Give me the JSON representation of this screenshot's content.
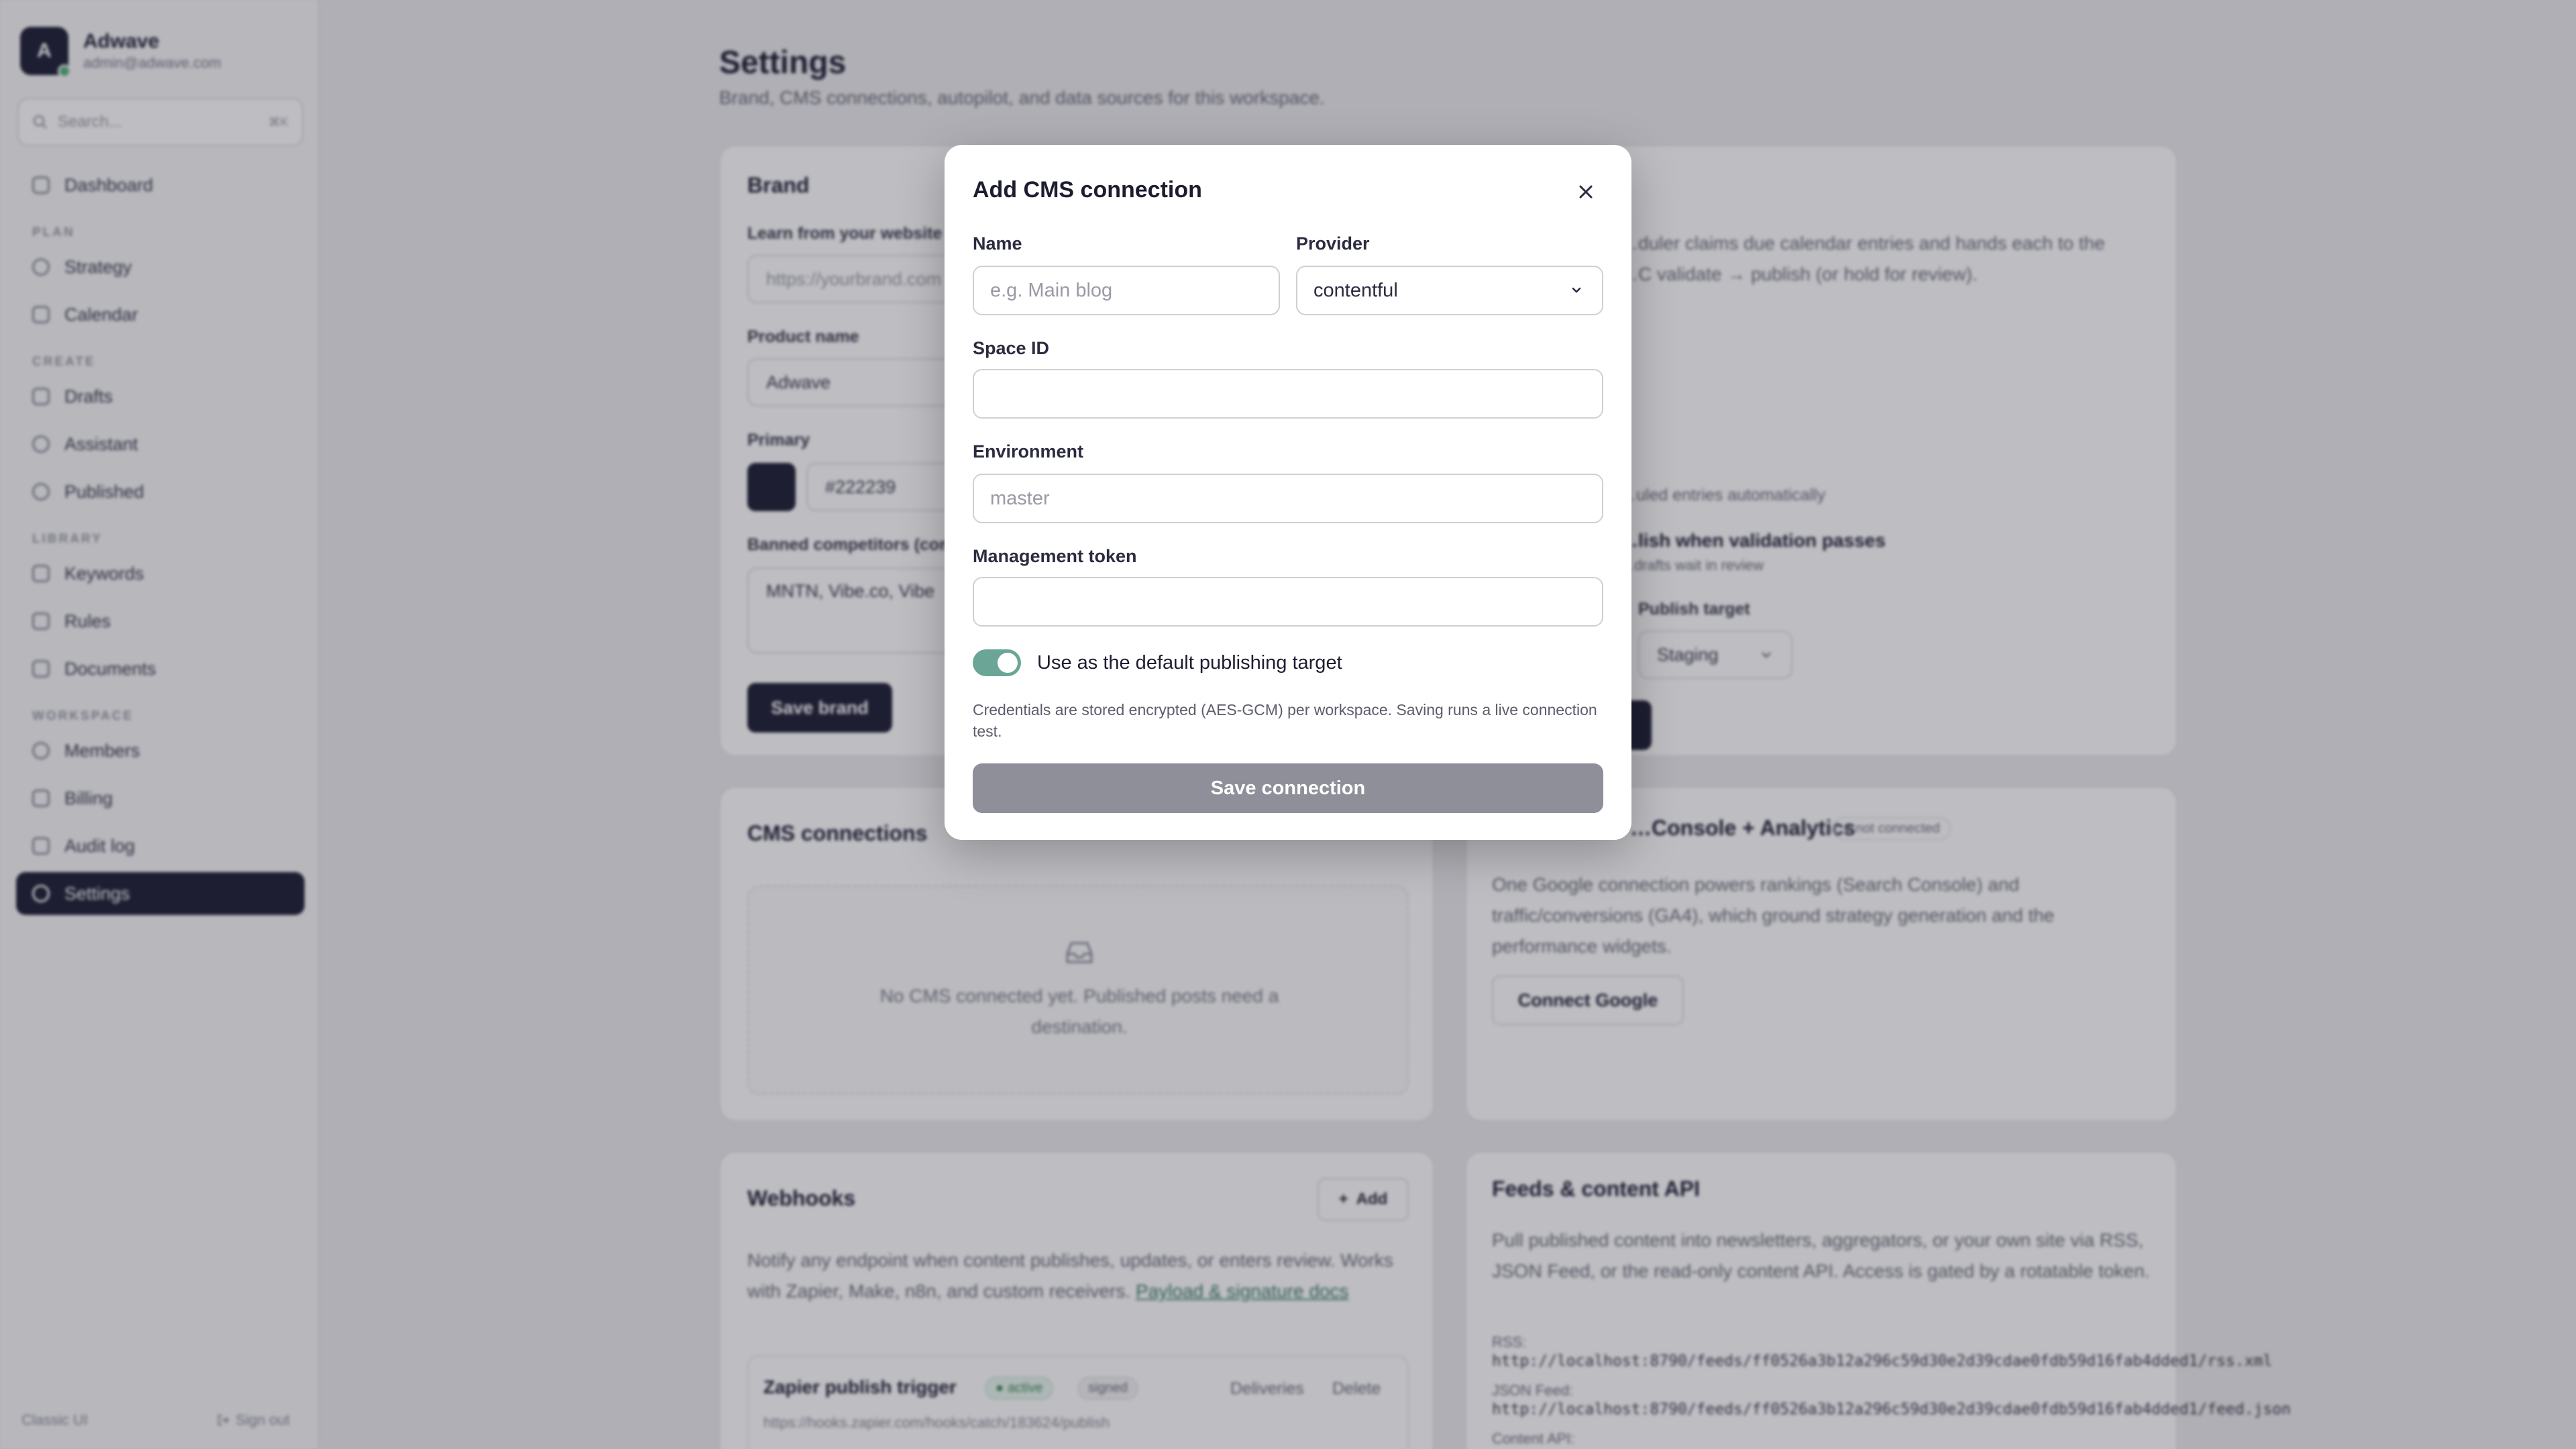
{
  "workspace": {
    "initial": "A",
    "name": "Adwave",
    "email": "admin@adwave.com"
  },
  "search": {
    "placeholder": "Search...",
    "shortcut": "⌘K"
  },
  "nav": {
    "dashboard": "Dashboard",
    "plan_section": "PLAN",
    "strategy": "Strategy",
    "calendar": "Calendar",
    "create_section": "CREATE",
    "drafts": "Drafts",
    "assistant": "Assistant",
    "published": "Published",
    "library_section": "LIBRARY",
    "keywords": "Keywords",
    "rules": "Rules",
    "documents": "Documents",
    "workspace_section": "WORKSPACE",
    "members": "Members",
    "billing": "Billing",
    "audit_log": "Audit log",
    "settings": "Settings"
  },
  "sidebar_footer": {
    "classic_ui": "Classic UI",
    "sign_out": "Sign out"
  },
  "page": {
    "title": "Settings",
    "subtitle": "Brand, CMS connections, autopilot, and data sources for this workspace."
  },
  "brand_card": {
    "title": "Brand",
    "learn_label": "Learn from your website",
    "website_placeholder": "https://yourbrand.com",
    "product_label": "Product name",
    "product_value": "Adwave",
    "primary_label": "Primary",
    "primary_value": "#222239",
    "banned_label": "Banned competitors (comma-separated)",
    "banned_value": "MNTN, Vibe.co, Vibe",
    "save_label": "Save brand"
  },
  "autopilot_card": {
    "desc_line1": "…duler claims due calendar entries and hands each to the",
    "desc_line2": "…C validate → publish (or hold for review).",
    "option1": "…uled entries automatically",
    "option2": "…lish when validation passes",
    "option2_sub": "…drafts wait in review",
    "publish_target_label": "Publish target",
    "publish_target_value": "Staging",
    "save_label": "t"
  },
  "cms_card": {
    "title": "CMS connections",
    "empty_text": "No CMS connected yet. Published posts need a destination."
  },
  "google_card": {
    "title": "…Console + Analytics",
    "badge": "not connected",
    "desc": "One Google connection powers rankings (Search Console) and traffic/conversions (GA4), which ground strategy generation and the performance widgets.",
    "connect_label": "Connect Google"
  },
  "webhooks_card": {
    "title": "Webhooks",
    "add_label": "Add",
    "desc": "Notify any endpoint when content publishes, updates, or enters review. Works with Zapier, Make, n8n, and custom receivers.",
    "docs_link": "Payload & signature docs",
    "hook_name": "Zapier publish trigger",
    "hook_status": "active",
    "hook_signed": "signed",
    "deliveries_label": "Deliveries",
    "delete_label": "Delete",
    "hook_url": "https://hooks.zapier.com/hooks/catch/183624/publish"
  },
  "feeds_card": {
    "title": "Feeds & content API",
    "desc": "Pull published content into newsletters, aggregators, or your own site via RSS, JSON Feed, or the read-only content API. Access is gated by a rotatable token.",
    "rss_label": "RSS:",
    "rss_url": "http://localhost:8790/feeds/ff0526a3b12a296c59d30e2d39cdae0fdb59d16fab4dded1/rss.xml",
    "json_label": "JSON Feed:",
    "json_url": "http://localhost:8790/feeds/ff0526a3b12a296c59d30e2d39cdae0fdb59d16fab4dded1/feed.json",
    "api_label": "Content API:"
  },
  "modal": {
    "title": "Add CMS connection",
    "name_label": "Name",
    "name_placeholder": "e.g. Main blog",
    "provider_label": "Provider",
    "provider_value": "contentful",
    "space_label": "Space ID",
    "space_value": "",
    "environment_label": "Environment",
    "environment_placeholder": "master",
    "token_label": "Management token",
    "token_value": "",
    "default_toggle_label": "Use as the default publishing target",
    "default_toggle_on": true,
    "help_text": "Credentials are stored encrypted (AES-GCM) per workspace. Saving runs a live connection test.",
    "save_label": "Save connection"
  },
  "colors": {
    "primary": "#222239",
    "toggle_on": "#6aa595",
    "save_disabled": "#8e8f99",
    "status_active": "#5ab27a"
  }
}
